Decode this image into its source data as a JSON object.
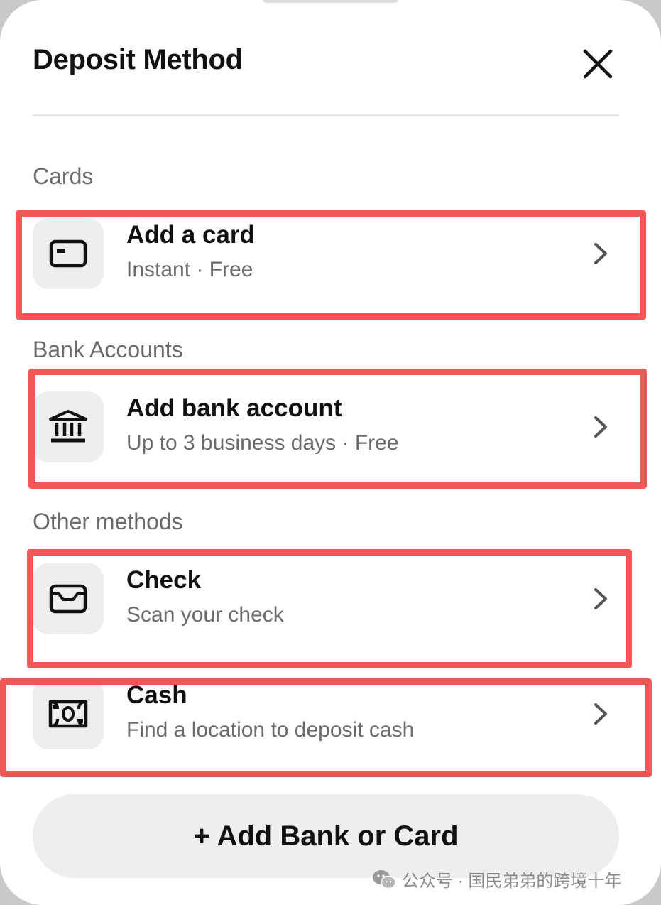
{
  "header": {
    "title": "Deposit Method",
    "close_icon": "close-icon"
  },
  "sections": {
    "cards": "Cards",
    "bank_accounts": "Bank Accounts",
    "other_methods": "Other methods"
  },
  "methods": [
    {
      "title": "Add a card",
      "subtitle": "Instant · Free",
      "icon": "card-icon"
    },
    {
      "title": "Add bank account",
      "subtitle": "Up to 3 business days · Free",
      "icon": "bank-icon"
    },
    {
      "title": "Check",
      "subtitle": "Scan your check",
      "icon": "check-icon"
    },
    {
      "title": "Cash",
      "subtitle": "Find a location to deposit cash",
      "icon": "cash-icon"
    }
  ],
  "footer": {
    "add_button_label": "+ Add Bank or Card"
  },
  "watermark": {
    "text": "公众号 · 国民弟弟的跨境十年"
  },
  "colors": {
    "highlight": "#f25757",
    "tile_bg": "#eeeeee",
    "text_primary": "#111111",
    "text_secondary": "#6b6b6b"
  }
}
